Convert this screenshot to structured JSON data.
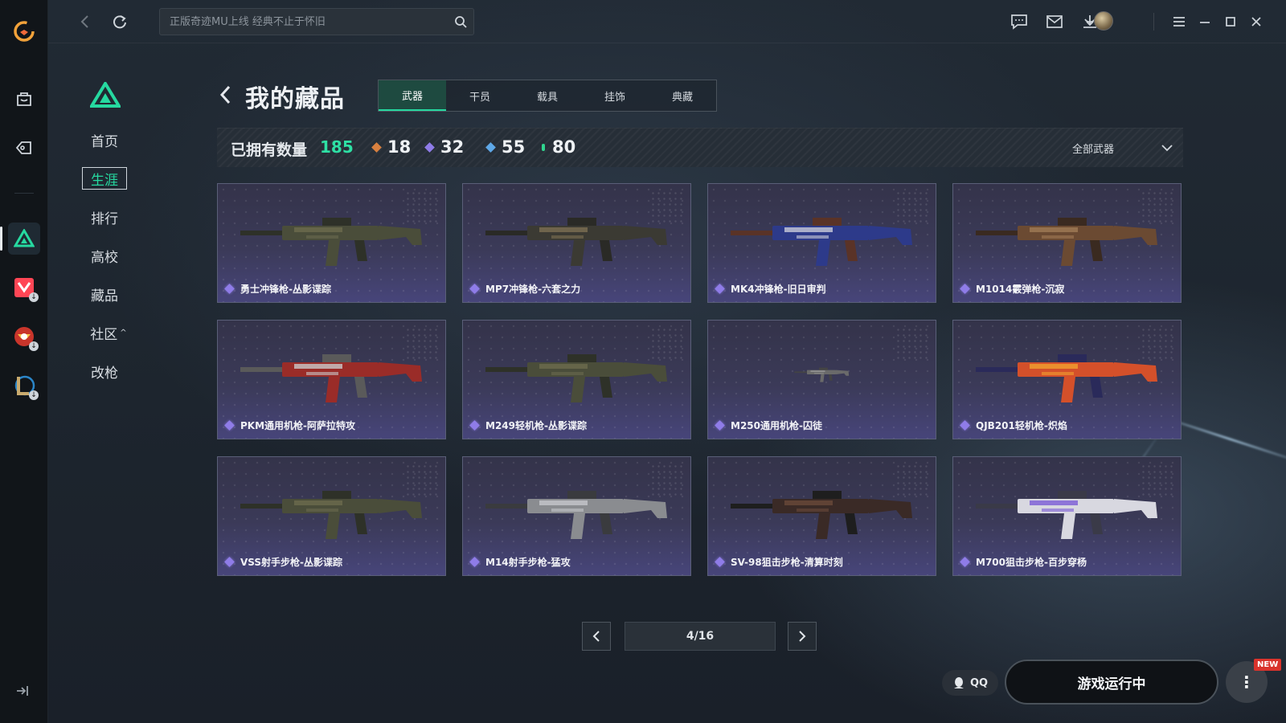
{
  "app": {
    "accent": "#26d9a0",
    "purple": "#8f7ce8"
  },
  "rail": {
    "icons": [
      "app-logo-icon",
      "store-bag-icon",
      "tag-icon",
      "game-triangle-icon",
      "valorant-icon",
      "crossfire-icon",
      "lol-icon",
      "collapse-icon"
    ]
  },
  "topbar": {
    "search_placeholder": "正版奇迹MU上线 经典不止于怀旧",
    "icons": [
      "chat-icon",
      "mail-icon",
      "download-icon",
      "avatar",
      "menu-icon",
      "minimize-icon",
      "maximize-icon",
      "close-icon"
    ]
  },
  "menu": {
    "items": [
      {
        "label": "首页"
      },
      {
        "label": "生涯"
      },
      {
        "label": "排行"
      },
      {
        "label": "高校"
      },
      {
        "label": "藏品"
      },
      {
        "label": "社区"
      },
      {
        "label": "改枪"
      }
    ],
    "caret": "^"
  },
  "page": {
    "title": "我的藏品",
    "tabs": [
      "武器",
      "干员",
      "载具",
      "挂饰",
      "典藏"
    ],
    "active_tab": 0
  },
  "stats": {
    "owned_label": "已拥有数量",
    "owned_count": "185",
    "tiers": [
      {
        "value": "18",
        "color": "#d8803f"
      },
      {
        "value": "32",
        "color": "#8f7ce8"
      },
      {
        "value": "55",
        "color": "#5ea8e8"
      },
      {
        "value": "80",
        "color": "#30d58f"
      }
    ],
    "filter_label": "全部武器"
  },
  "items": [
    {
      "name": "勇士冲锋枪-丛影谍踪",
      "skin": "camo"
    },
    {
      "name": "MP7冲锋枪-六套之力",
      "skin": "tan"
    },
    {
      "name": "MK4冲锋枪-旧日审判",
      "skin": "blue"
    },
    {
      "name": "M1014霰弹枪-沉寂",
      "skin": "bronze"
    },
    {
      "name": "PKM通用机枪-阿萨拉特攻",
      "skin": "red-silver"
    },
    {
      "name": "M249轻机枪-丛影谍踪",
      "skin": "camo"
    },
    {
      "name": "M250通用机枪-囚徒",
      "skin": "small-gray"
    },
    {
      "name": "QJB201轻机枪-炽焰",
      "skin": "flame"
    },
    {
      "name": "VSS射手步枪-丛影谍踪",
      "skin": "camo"
    },
    {
      "name": "M14射手步枪-猛攻",
      "skin": "silver"
    },
    {
      "name": "SV-98狙击步枪-清算时刻",
      "skin": "dark"
    },
    {
      "name": "M700狙击步枪-百步穿杨",
      "skin": "white-purple"
    }
  ],
  "pagination": {
    "label": "4/16",
    "current": 4,
    "total": 16
  },
  "bottom": {
    "qq_label": "QQ",
    "launch_label": "游戏运行中",
    "more_label": "⋮",
    "new_badge": "NEW"
  }
}
